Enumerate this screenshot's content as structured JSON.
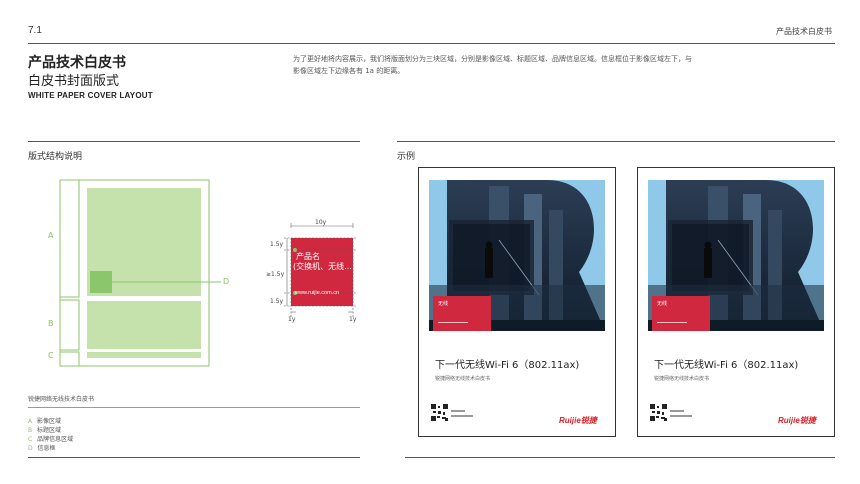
{
  "header": {
    "section_number": "7.1",
    "section_title": "产品技术白皮书"
  },
  "title": {
    "main": "产品技术白皮书",
    "sub": "白皮书封面版式",
    "english": "WHITE PAPER COVER LAYOUT"
  },
  "description": "为了更好地将内容展示，我们将版面划分为三块区域，分别是影像区域、标题区域、品牌信息区域。信息框位于影像区域左下，与影像区域左下边缘各有 1a 的距离。",
  "left_section": {
    "heading": "版式结构说明",
    "diagram_labels": {
      "a": "A",
      "b": "B",
      "c": "C",
      "d": "D"
    },
    "spec": {
      "top": "10y",
      "row1": "1.5y",
      "row2": "≥1.5y",
      "row3": "1.5y",
      "bottom_left": "1y",
      "bottom_right": "1y",
      "box_title": "产品名",
      "box_subtitle": "(交换机、无线...",
      "box_url": "www.ruijie.com.cn"
    },
    "caption": "锐捷网络无线技术白皮书",
    "legend": [
      {
        "key": "A",
        "label": "影像区域"
      },
      {
        "key": "B",
        "label": "标题区域"
      },
      {
        "key": "C",
        "label": "品牌信息区域"
      },
      {
        "key": "D",
        "label": "信息框"
      }
    ]
  },
  "right_section": {
    "heading": "示例",
    "covers": [
      {
        "tag": "无线",
        "title": "下一代无线Wi-Fi 6（802.11ax)",
        "subtitle": "锐捷网络无线技术白皮书",
        "brand": "Ruijie锐捷"
      },
      {
        "tag": "无线",
        "title": "下一代无线Wi-Fi 6（802.11ax)",
        "subtitle": "锐捷网络无线技术白皮书",
        "brand": "Ruijie锐捷"
      }
    ]
  },
  "colors": {
    "green": "#8cc66a",
    "green_light": "#c5e2ad",
    "red": "#d0283f",
    "sky": "#8fc8e8",
    "brand_red": "#d9222a"
  }
}
